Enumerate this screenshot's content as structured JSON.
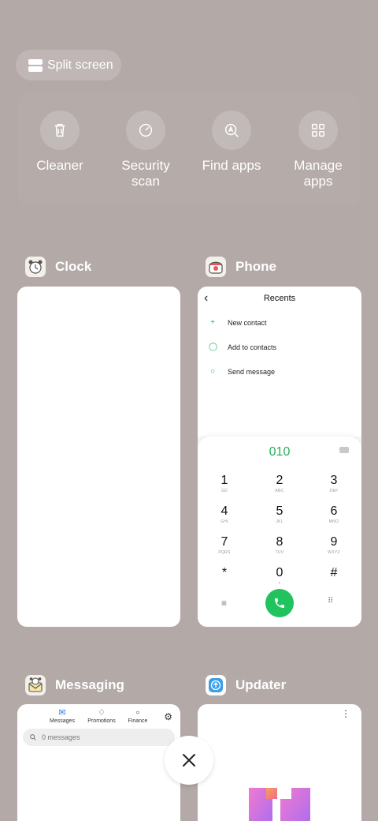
{
  "split_screen": {
    "label": "Split screen"
  },
  "quick_actions": [
    {
      "label": "Cleaner",
      "icon": "trash-icon"
    },
    {
      "label": "Security scan",
      "icon": "shield-scan-icon"
    },
    {
      "label": "Find apps",
      "icon": "search-apps-icon"
    },
    {
      "label": "Manage apps",
      "icon": "grid-icon"
    }
  ],
  "apps": {
    "clock": {
      "name": "Clock",
      "icon": "clock-app-icon"
    },
    "phone": {
      "name": "Phone",
      "icon": "phone-app-icon",
      "screen": {
        "title": "Recents",
        "options": [
          "New contact",
          "Add to contacts",
          "Send message"
        ],
        "dialed_number": "010",
        "keys": [
          {
            "digit": "1",
            "letters": "GD"
          },
          {
            "digit": "2",
            "letters": "ABC"
          },
          {
            "digit": "3",
            "letters": "DEF"
          },
          {
            "digit": "4",
            "letters": "GHI"
          },
          {
            "digit": "5",
            "letters": "JKL"
          },
          {
            "digit": "6",
            "letters": "MNO"
          },
          {
            "digit": "7",
            "letters": "PQRS"
          },
          {
            "digit": "8",
            "letters": "TUV"
          },
          {
            "digit": "9",
            "letters": "WXYZ"
          },
          {
            "digit": "*",
            "letters": ","
          },
          {
            "digit": "0",
            "letters": "+"
          },
          {
            "digit": "#",
            "letters": ""
          }
        ]
      }
    },
    "messaging": {
      "name": "Messaging",
      "icon": "messaging-app-icon",
      "screen": {
        "tabs": [
          "Messages",
          "Promotions",
          "Finance"
        ],
        "search_placeholder": "0 messages"
      }
    },
    "updater": {
      "name": "Updater",
      "icon": "updater-app-icon"
    }
  },
  "colors": {
    "background": "#b3a9a7",
    "dial_green": "#22c35e",
    "accent_blue": "#2e7be6"
  }
}
